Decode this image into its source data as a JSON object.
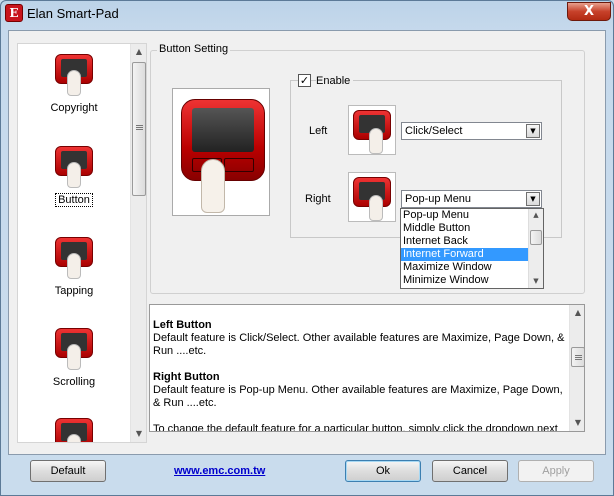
{
  "window": {
    "title": "Elan Smart-Pad",
    "app_icon_glyph": "E",
    "close_glyph": "X"
  },
  "sidebar": {
    "items": [
      {
        "label": "Copyright",
        "icon": "copyright-pad-icon"
      },
      {
        "label": "Button",
        "icon": "button-pad-icon",
        "selected": true
      },
      {
        "label": "Tapping",
        "icon": "tapping-pad-icon"
      },
      {
        "label": "Scrolling",
        "icon": "scrolling-pad-icon"
      },
      {
        "label": "",
        "icon": "pad-icon"
      }
    ]
  },
  "button_setting": {
    "group_title": "Button Setting",
    "enable_label": "Enable",
    "enable_checked": true,
    "check_glyph": "✓",
    "left_label": "Left",
    "left_value": "Click/Select",
    "right_label": "Right",
    "right_value": "Pop-up Menu",
    "dropdown_options": [
      "Pop-up Menu",
      "Middle Button",
      "Internet Back",
      "Internet Forward",
      "Maximize  Window",
      "Minimize Window"
    ],
    "dropdown_selected_index": 3
  },
  "description": {
    "left_title": "Left Button",
    "left_text": "Default feature is Click/Select. Other available features are Maximize, Page Down, & Run ....etc.",
    "right_title": "Right Button",
    "right_text": "Default feature is Pop-up Menu. Other available features are Maximize, Page Down, & Run ....etc.",
    "change_text": "To change the default feature for a particular button, simply click the dropdown next"
  },
  "footer": {
    "default_label": "Default",
    "link_text": "www.emc.com.tw",
    "ok_label": "Ok",
    "cancel_label": "Cancel",
    "apply_label": "Apply"
  },
  "colors": {
    "selection": "#3399ff",
    "pad_red": "#cc1111",
    "link": "#0000cc"
  }
}
